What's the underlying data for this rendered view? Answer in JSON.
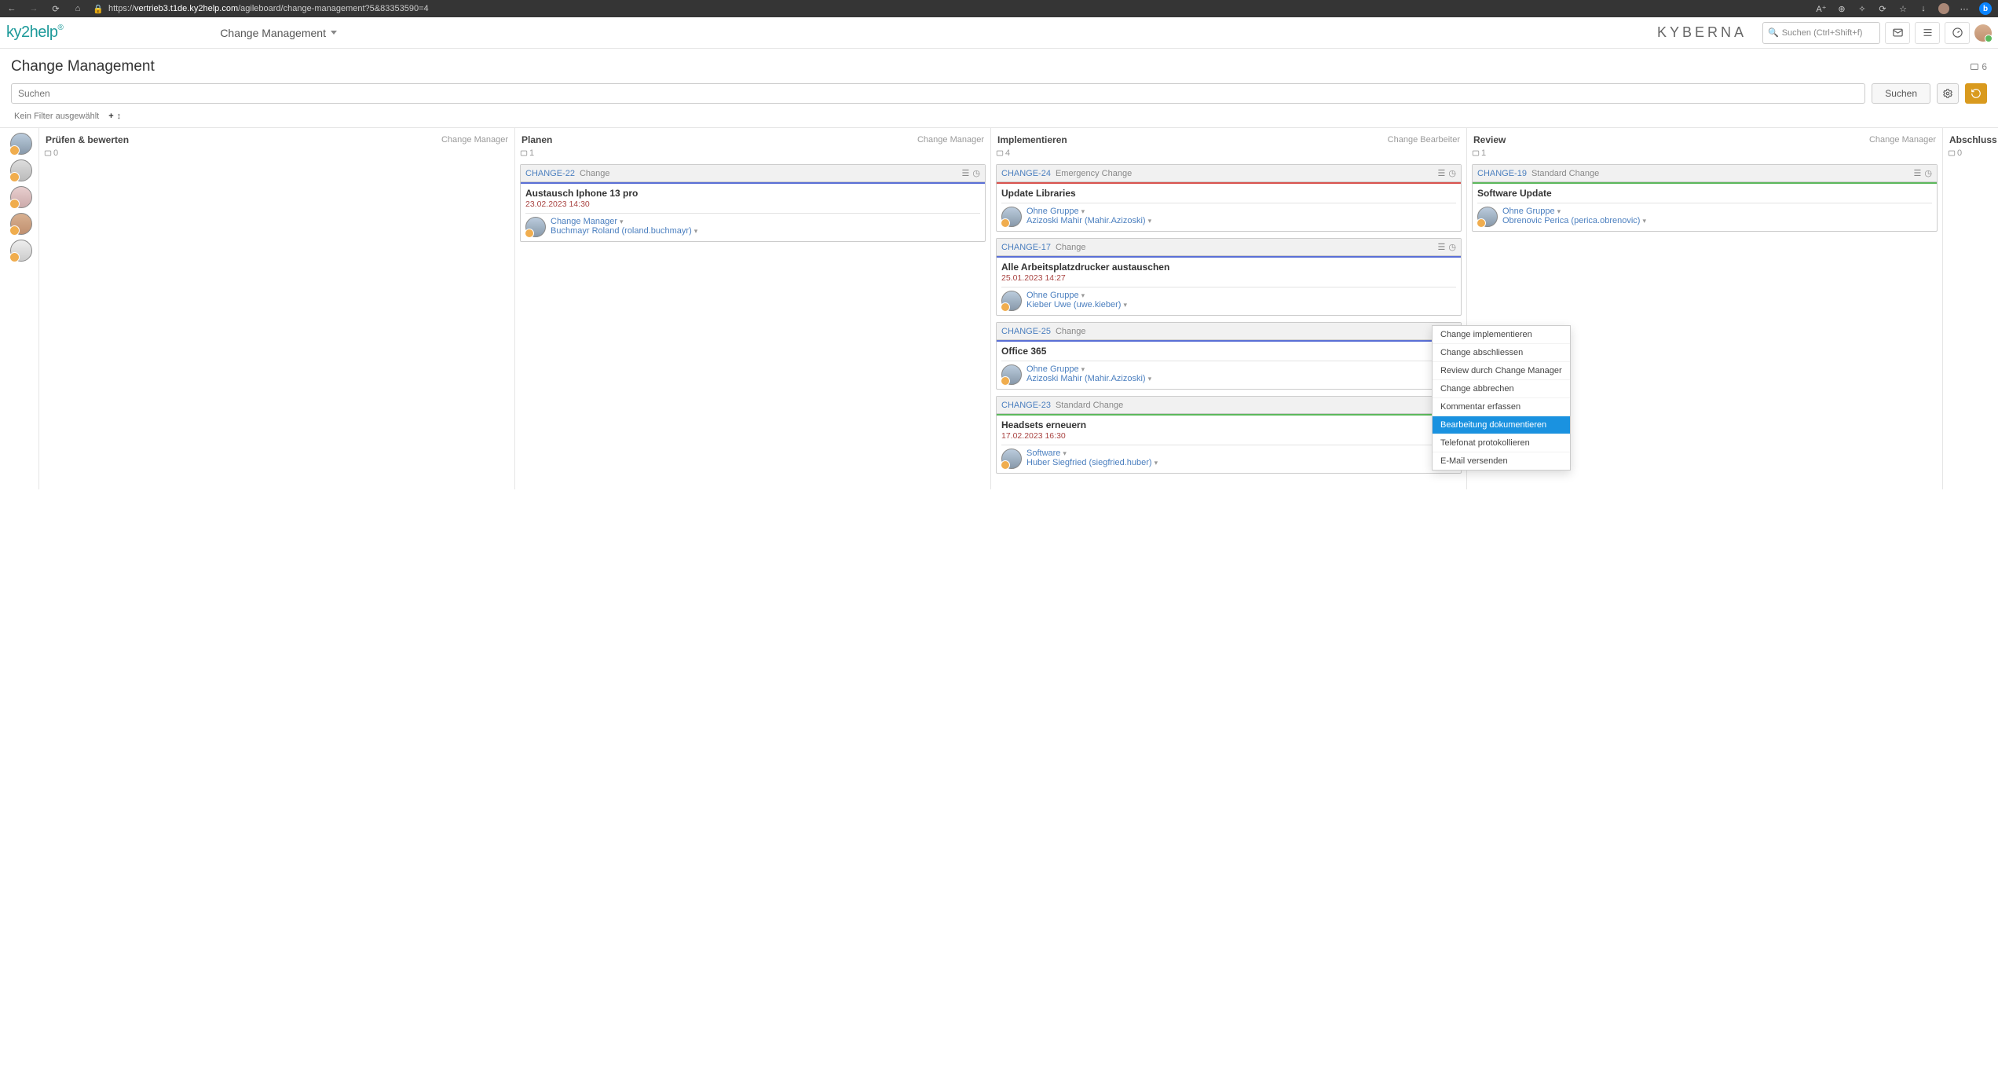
{
  "browser": {
    "url_prefix": "https://",
    "url_host": "vertrieb3.t1de.ky2help.com",
    "url_path": "/agileboard/change-management?5&83353590=4"
  },
  "app": {
    "logo": "ky2help",
    "logo_sup": "®",
    "breadcrumb": "Change Management",
    "brand_logo": "KYBERNA",
    "search_placeholder": "Suchen (Ctrl+Shift+f)"
  },
  "page": {
    "title": "Change Management",
    "total_count": "6",
    "search_placeholder": "Suchen",
    "search_button": "Suchen",
    "filter_label": "Kein Filter ausgewählt"
  },
  "columns": [
    {
      "title": "Prüfen & bewerten",
      "role": "Change Manager",
      "count": "0"
    },
    {
      "title": "Planen",
      "role": "Change Manager",
      "count": "1"
    },
    {
      "title": "Implementieren",
      "role": "Change Bearbeiter",
      "count": "4"
    },
    {
      "title": "Review",
      "role": "Change Manager",
      "count": "1"
    },
    {
      "title": "Abschluss",
      "role": "",
      "count": "0"
    }
  ],
  "cards": {
    "planen": [
      {
        "id": "CHANGE-22",
        "type": "Change",
        "stripe": "#5a6fd6",
        "title": "Austausch Iphone 13 pro",
        "date": "23.02.2023 14:30",
        "group": "Change Manager",
        "person": "Buchmayr Roland (roland.buchmayr)"
      }
    ],
    "implementieren": [
      {
        "id": "CHANGE-24",
        "type": "Emergency Change",
        "stripe": "#d9534f",
        "title": "Update Libraries",
        "date": "",
        "group": "Ohne Gruppe",
        "person": "Azizoski Mahir (Mahir.Azizoski)"
      },
      {
        "id": "CHANGE-17",
        "type": "Change",
        "stripe": "#5a6fd6",
        "title": "Alle Arbeitsplatzdrucker austauschen",
        "date": "25.01.2023 14:27",
        "group": "Ohne Gruppe",
        "person": "Kieber Uwe (uwe.kieber)"
      },
      {
        "id": "CHANGE-25",
        "type": "Change",
        "stripe": "#5a6fd6",
        "title": "Office 365",
        "date": "",
        "group": "Ohne Gruppe",
        "person": "Azizoski Mahir (Mahir.Azizoski)"
      },
      {
        "id": "CHANGE-23",
        "type": "Standard Change",
        "stripe": "#5cb85c",
        "title": "Headsets erneuern",
        "date": "17.02.2023 16:30",
        "group": "Software",
        "person": "Huber Siegfried (siegfried.huber)"
      }
    ],
    "review": [
      {
        "id": "CHANGE-19",
        "type": "Standard Change",
        "stripe": "#5cb85c",
        "title": "Software Update",
        "date": "",
        "group": "Ohne Gruppe",
        "person": "Obrenovic Perica (perica.obrenovic)"
      }
    ]
  },
  "context_menu": {
    "items": [
      "Change implementieren",
      "Change abschliessen",
      "Review durch Change Manager",
      "Change abbrechen",
      "Kommentar erfassen",
      "Bearbeitung dokumentieren",
      "Telefonat protokollieren",
      "E-Mail versenden"
    ],
    "highlighted_index": 5
  }
}
